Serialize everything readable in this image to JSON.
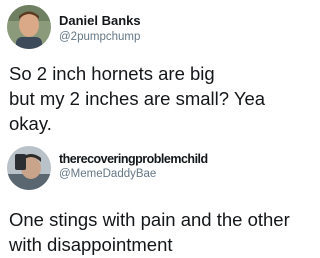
{
  "posts": [
    {
      "display_name": "Daniel Banks",
      "handle": "@2pumpchump",
      "text_lines": [
        "So 2 inch hornets are big",
        "but my 2 inches are small? Yea",
        "okay."
      ]
    },
    {
      "display_name": "therecoveringproblemchild",
      "handle": "@MemeDaddyBae",
      "text_lines": [
        "One stings with pain and the other",
        "with disappointment"
      ]
    }
  ],
  "colors": {
    "text": "#14171a",
    "handle": "#657786",
    "background": "#ffffff"
  }
}
